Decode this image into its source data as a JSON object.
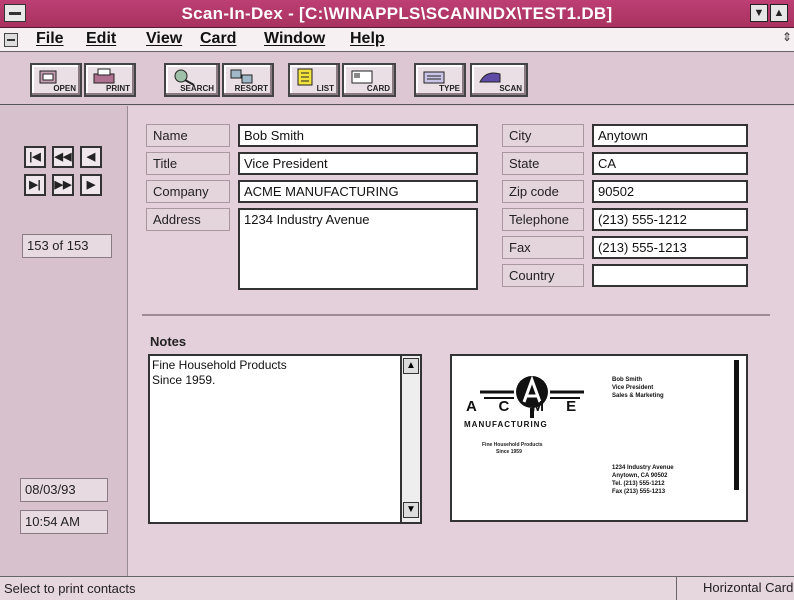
{
  "window": {
    "title": "Scan-In-Dex - [C:\\WINAPPLS\\SCANINDX\\TEST1.DB]",
    "min_glyph": "▼",
    "max_glyph": "▲"
  },
  "menu": {
    "items": [
      "File",
      "Edit",
      "View",
      "Card",
      "Window",
      "Help"
    ],
    "right_glyph": "⇕"
  },
  "toolbar": {
    "buttons": [
      {
        "label": "OPEN",
        "icon": "open-icon"
      },
      {
        "label": "PRINT",
        "icon": "print-icon"
      },
      {
        "label": "SEARCH",
        "icon": "search-icon"
      },
      {
        "label": "RESORT",
        "icon": "resort-icon"
      },
      {
        "label": "LIST",
        "icon": "list-icon"
      },
      {
        "label": "CARD",
        "icon": "card-icon"
      },
      {
        "label": "TYPE",
        "icon": "type-icon"
      },
      {
        "label": "SCAN",
        "icon": "scan-icon"
      }
    ]
  },
  "nav": {
    "first": "|◀",
    "prev_page": "◀◀",
    "prev": "◀",
    "last": "▶|",
    "next_page": "▶▶",
    "next": "▶",
    "counter": "153 of 153",
    "date": "08/03/93",
    "time": "10:54 AM"
  },
  "fields_left": [
    {
      "label": "Name",
      "value": "Bob Smith"
    },
    {
      "label": "Title",
      "value": "Vice President"
    },
    {
      "label": "Company",
      "value": "ACME MANUFACTURING"
    },
    {
      "label": "Address",
      "value": "1234 Industry Avenue"
    }
  ],
  "fields_right": [
    {
      "label": "City",
      "value": "Anytown"
    },
    {
      "label": "State",
      "value": "CA"
    },
    {
      "label": "Zip code",
      "value": "90502"
    },
    {
      "label": "Telephone",
      "value": "(213) 555-1212"
    },
    {
      "label": "Fax",
      "value": "(213) 555-1213"
    },
    {
      "label": "Country",
      "value": ""
    }
  ],
  "notes": {
    "label": "Notes",
    "line1": "Fine Household Products",
    "line2": "Since 1959."
  },
  "card_image": {
    "brand": "A C M E",
    "brand_sub": "MANUFACTURING",
    "tagline_line1": "Fine Household Products",
    "tagline_line2": "Since 1959",
    "person_line1": "Bob Smith",
    "person_line2": "Vice President",
    "person_line3": "Sales & Marketing",
    "addr_line1": "1234 Industry Avenue",
    "addr_line2": "Anytown, CA 90502",
    "addr_line3": "Tel. (213) 555-1212",
    "addr_line4": "Fax (213) 555-1213"
  },
  "status": {
    "left": "Select to print contacts",
    "right": "Horizontal Card"
  },
  "colors": {
    "titlebar": "#bd3f74",
    "background": "#d9c3cf"
  }
}
